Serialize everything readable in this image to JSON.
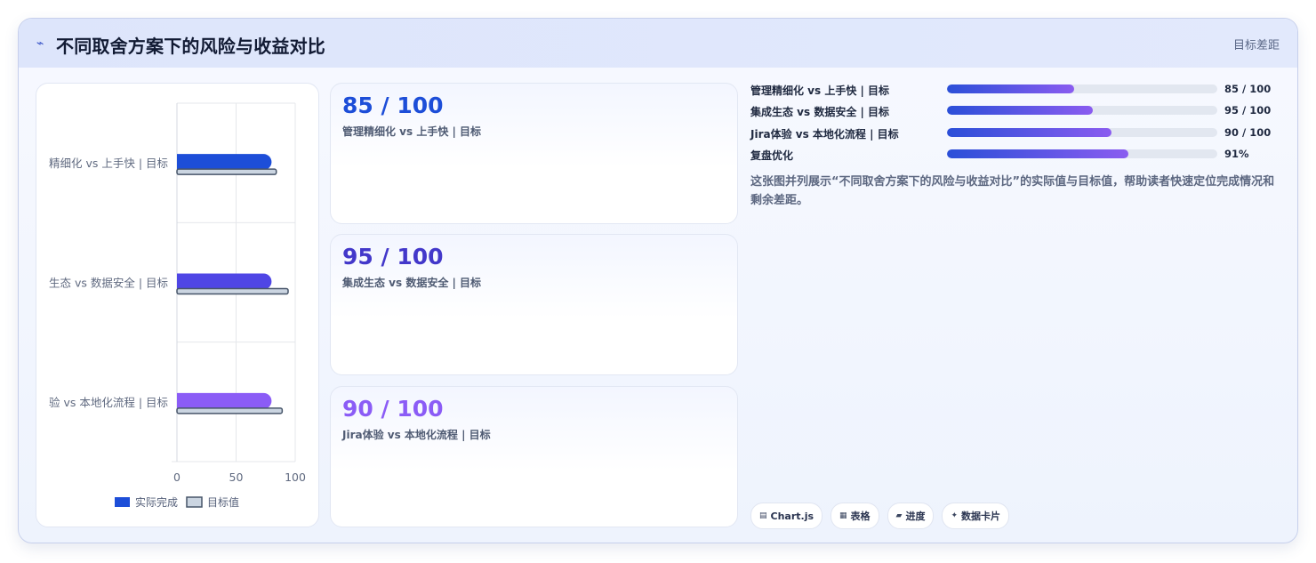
{
  "header": {
    "icon": "sparkline-icon",
    "title": "不同取舍方案下的风险与收益对比",
    "tag": "目标差距"
  },
  "chart_data": {
    "type": "bar",
    "orientation": "horizontal",
    "categories": [
      "精细化 vs 上手快 | 目标",
      "生态 vs 数据安全 | 目标",
      "验 vs 本地化流程 | 目标"
    ],
    "series": [
      {
        "name": "实际完成",
        "values": [
          80,
          80,
          80
        ],
        "colors": [
          "#1d4ed8",
          "#4f46e5",
          "#8b5cf6"
        ]
      },
      {
        "name": "目标值",
        "values": [
          84,
          94,
          89
        ],
        "color": "#cbd5e1",
        "border": "#475569"
      }
    ],
    "xticks": [
      "0",
      "50",
      "100"
    ],
    "xlim": [
      0,
      100
    ],
    "grid": true,
    "legend": "bottom"
  },
  "kpis": [
    {
      "value": "85 / 100",
      "label": "管理精细化 vs 上手快 | 目标",
      "color": "#1d4ed8"
    },
    {
      "value": "95 / 100",
      "label": "集成生态 vs 数据安全 | 目标",
      "color": "#4338ca"
    },
    {
      "value": "90 / 100",
      "label": "Jira体验 vs 本地化流程 | 目标",
      "color": "#8b5cf6"
    }
  ],
  "progress": [
    {
      "label": "管理精细化 vs 上手快 | 目标",
      "value": "85 / 100",
      "fraction": 0.47
    },
    {
      "label": "集成生态 vs 数据安全 | 目标",
      "value": "95 / 100",
      "fraction": 0.54
    },
    {
      "label": "Jira体验 vs 本地化流程 | 目标",
      "value": "90 / 100",
      "fraction": 0.61
    },
    {
      "label": "复盘优化",
      "value": "91%",
      "fraction": 0.67
    }
  ],
  "description": "这张图并列展示“不同取舍方案下的风险与收益对比”的实际值与目标值，帮助读者快速定位完成情况和剩余差距。",
  "chips": [
    {
      "icon": "▤",
      "label": "Chart.js"
    },
    {
      "icon": "▦",
      "label": "表格"
    },
    {
      "icon": "▰",
      "label": "进度"
    },
    {
      "icon": "✦",
      "label": "数据卡片"
    }
  ]
}
